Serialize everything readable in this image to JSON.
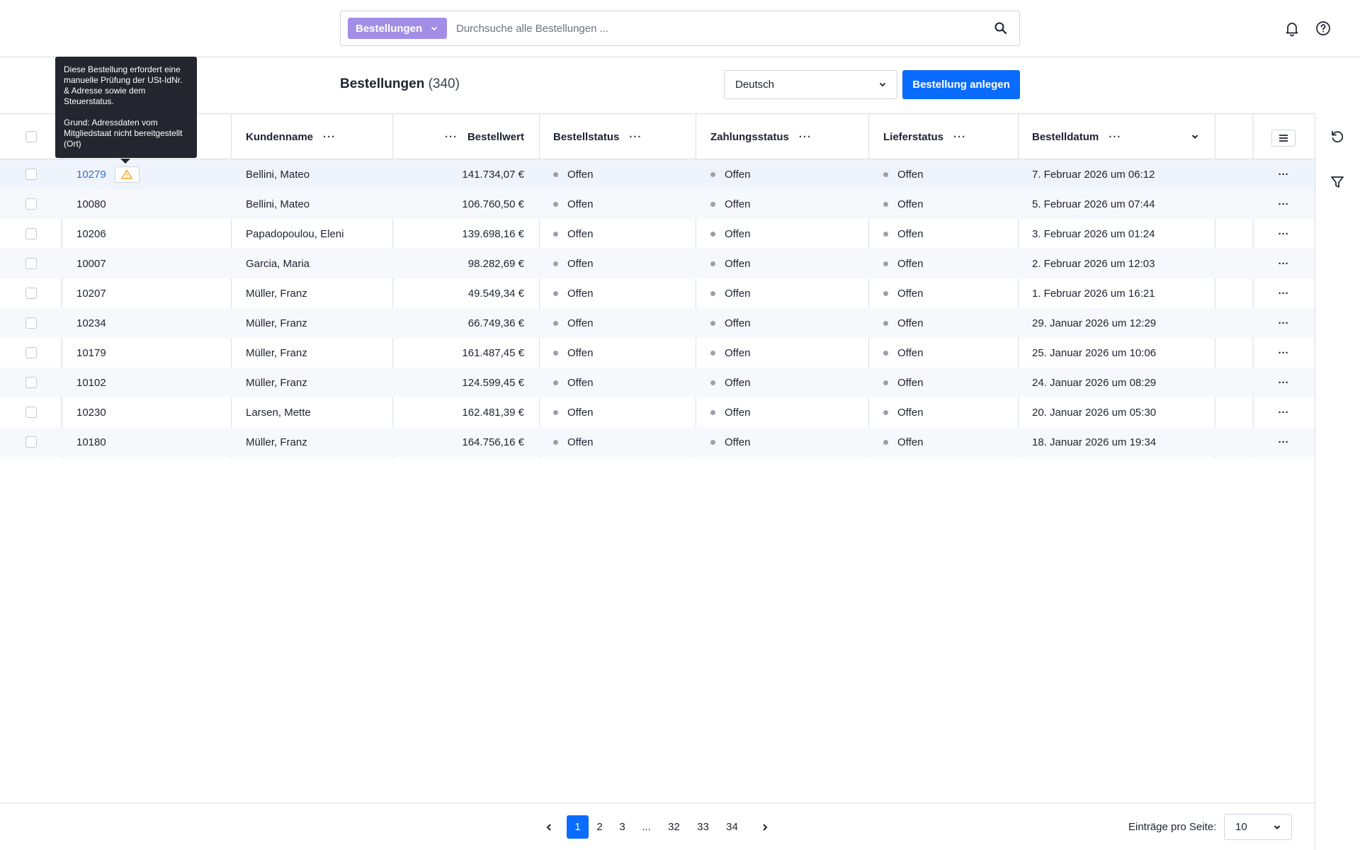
{
  "search": {
    "scope_label": "Bestellungen",
    "placeholder": "Durchsuche alle Bestellungen ..."
  },
  "page": {
    "title": "Bestellungen",
    "count": "(340)",
    "language": "Deutsch",
    "create_button": "Bestellung anlegen"
  },
  "table": {
    "columns": {
      "kundenname": "Kundenname",
      "bestellwert": "Bestellwert",
      "bestellstatus": "Bestellstatus",
      "zahlungsstatus": "Zahlungsstatus",
      "lieferstatus": "Lieferstatus",
      "bestelldatum": "Bestelldatum"
    },
    "rows": [
      {
        "id": "10279",
        "name": "Bellini, Mateo",
        "value": "141.734,07 €",
        "order": "Offen",
        "payment": "Offen",
        "delivery": "Offen",
        "date": "7. Februar 2026 um 06:12"
      },
      {
        "id": "10080",
        "name": "Bellini, Mateo",
        "value": "106.760,50 €",
        "order": "Offen",
        "payment": "Offen",
        "delivery": "Offen",
        "date": "5. Februar 2026 um 07:44"
      },
      {
        "id": "10206",
        "name": "Papadopoulou, Eleni",
        "value": "139.698,16 €",
        "order": "Offen",
        "payment": "Offen",
        "delivery": "Offen",
        "date": "3. Februar 2026 um 01:24"
      },
      {
        "id": "10007",
        "name": "Garcia, Maria",
        "value": "98.282,69 €",
        "order": "Offen",
        "payment": "Offen",
        "delivery": "Offen",
        "date": "2. Februar 2026 um 12:03"
      },
      {
        "id": "10207",
        "name": "Müller, Franz",
        "value": "49.549,34 €",
        "order": "Offen",
        "payment": "Offen",
        "delivery": "Offen",
        "date": "1. Februar 2026 um 16:21"
      },
      {
        "id": "10234",
        "name": "Müller, Franz",
        "value": "66.749,36 €",
        "order": "Offen",
        "payment": "Offen",
        "delivery": "Offen",
        "date": "29. Januar 2026 um 12:29"
      },
      {
        "id": "10179",
        "name": "Müller, Franz",
        "value": "161.487,45 €",
        "order": "Offen",
        "payment": "Offen",
        "delivery": "Offen",
        "date": "25. Januar 2026 um 10:06"
      },
      {
        "id": "10102",
        "name": "Müller, Franz",
        "value": "124.599,45 €",
        "order": "Offen",
        "payment": "Offen",
        "delivery": "Offen",
        "date": "24. Januar 2026 um 08:29"
      },
      {
        "id": "10230",
        "name": "Larsen, Mette",
        "value": "162.481,39 €",
        "order": "Offen",
        "payment": "Offen",
        "delivery": "Offen",
        "date": "20. Januar 2026 um 05:30"
      },
      {
        "id": "10180",
        "name": "Müller, Franz",
        "value": "164.756,16 €",
        "order": "Offen",
        "payment": "Offen",
        "delivery": "Offen",
        "date": "18. Januar 2026 um 19:34"
      }
    ]
  },
  "tooltip": {
    "line1": "Diese Bestellung erfordert eine manuelle Prüfung der USt-IdNr. & Adresse sowie dem Steuerstatus.",
    "line2": "Grund: Adressdaten vom Mitgliedstaat nicht bereitgestellt (Ort)"
  },
  "pagination": {
    "pages": [
      "1",
      "2",
      "3",
      "...",
      "32",
      "33",
      "34"
    ],
    "active": "1",
    "per_page_label": "Einträge pro Seite:",
    "per_page_value": "10"
  },
  "icons": {
    "search": "search-icon",
    "notifications": "bell-icon",
    "help": "help-icon",
    "reset": "reset-icon",
    "filter": "filter-icon",
    "warning": "warning-icon",
    "columns_menu": "hamburger-icon"
  },
  "colors": {
    "primary": "#0a6cff",
    "scope": "#a28ee6",
    "link": "#2f6fd6",
    "warning": "#f5a524",
    "status_dot": "#9aa1ad"
  }
}
